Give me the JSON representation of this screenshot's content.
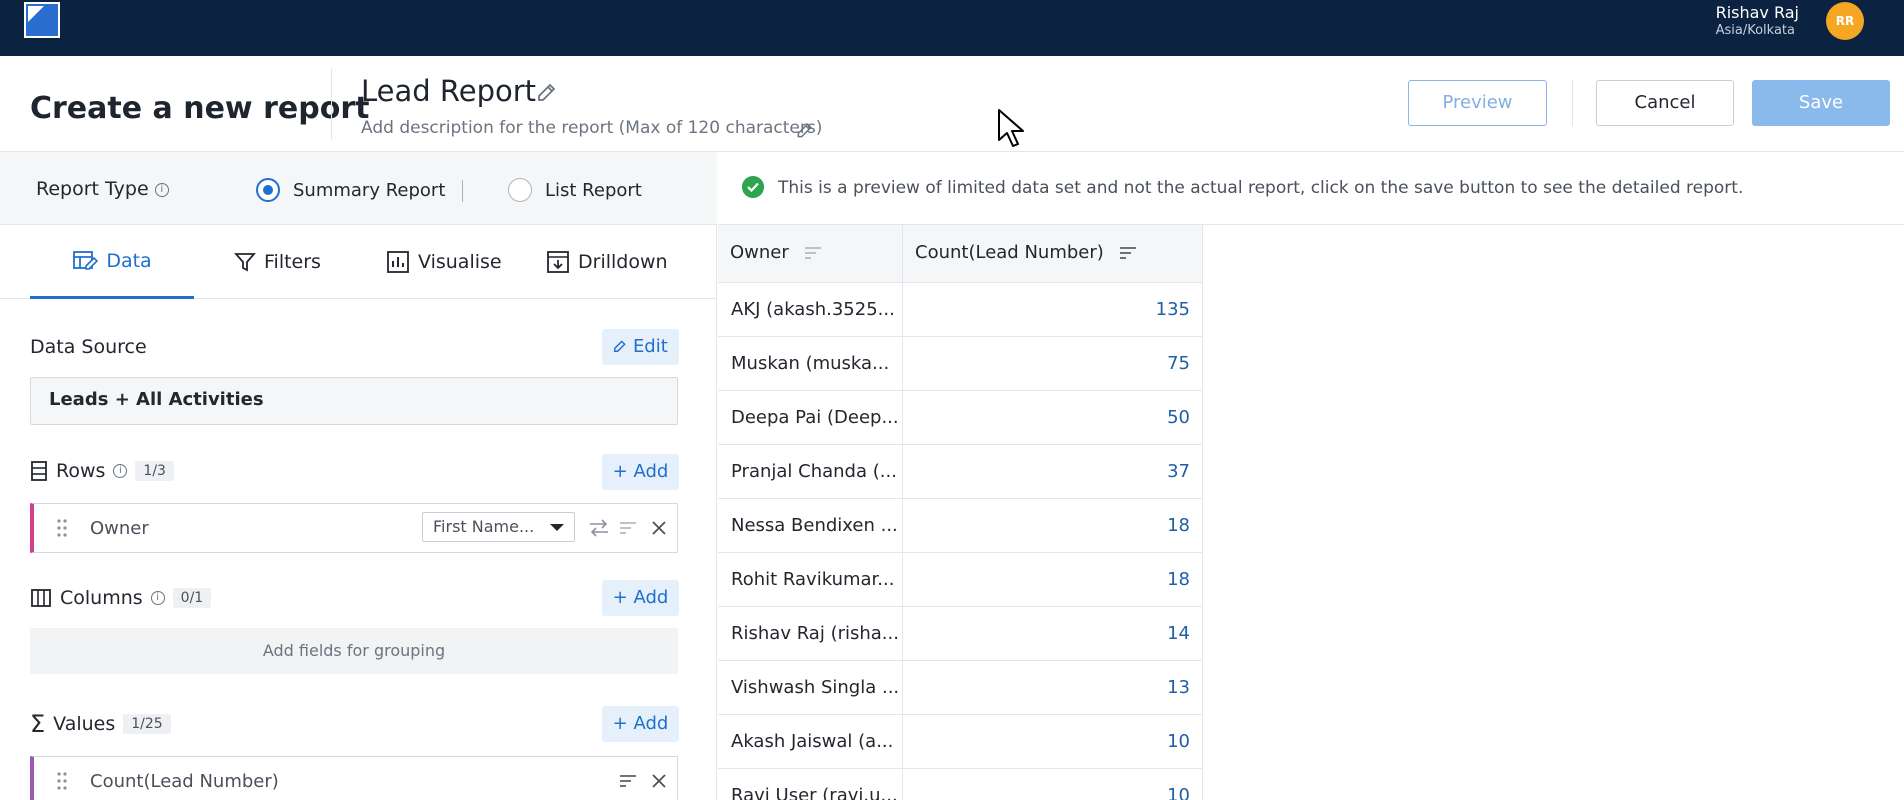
{
  "user": {
    "name": "Rishav Raj",
    "timezone": "Asia/Kolkata",
    "initials": "RR"
  },
  "header": {
    "page_title": "Create a new report",
    "report_name": "Lead Report",
    "report_description": "Add description for the report (Max of 120 characters)",
    "preview_label": "Preview",
    "cancel_label": "Cancel",
    "save_label": "Save"
  },
  "report_type": {
    "label": "Report Type",
    "options": [
      "Summary Report",
      "List Report"
    ],
    "selected": "Summary Report"
  },
  "tabs": [
    "Data",
    "Filters",
    "Visualise",
    "Drilldown"
  ],
  "active_tab": "Data",
  "data_source": {
    "label": "Data Source",
    "edit_label": "Edit",
    "value": "Leads + All Activities"
  },
  "rows": {
    "label": "Rows",
    "count": "1/3",
    "add_label": "+ Add",
    "items": [
      {
        "field": "Owner",
        "display": "First Name..."
      }
    ]
  },
  "columns": {
    "label": "Columns",
    "count": "0/1",
    "add_label": "+ Add",
    "placeholder": "Add fields for grouping"
  },
  "values": {
    "label": "Values",
    "count": "1/25",
    "add_label": "+ Add",
    "items": [
      {
        "field": "Count(Lead Number)"
      }
    ]
  },
  "notice": "This is a preview of limited data set and not the actual report, click on the save button to see the detailed report.",
  "table": {
    "headers": [
      "Owner",
      "Count(Lead Number)"
    ],
    "rows": [
      [
        "AKJ (akash.3525...",
        "135"
      ],
      [
        "Muskan (muska...",
        "75"
      ],
      [
        "Deepa Pai (Deep...",
        "50"
      ],
      [
        "Pranjal Chanda (...",
        "37"
      ],
      [
        "Nessa Bendixen ...",
        "18"
      ],
      [
        "Rohit Ravikumar...",
        "18"
      ],
      [
        "Rishav Raj (risha...",
        "14"
      ],
      [
        "Vishwash Singla ...",
        "13"
      ],
      [
        "Akash Jaiswal (a...",
        "10"
      ],
      [
        "Ravi User (ravi.u...",
        "10"
      ]
    ]
  },
  "colors": {
    "nav_bg": "#0b2240",
    "accent": "#1f6fd0",
    "avatar": "#f5a623",
    "success": "#2ea44f"
  }
}
